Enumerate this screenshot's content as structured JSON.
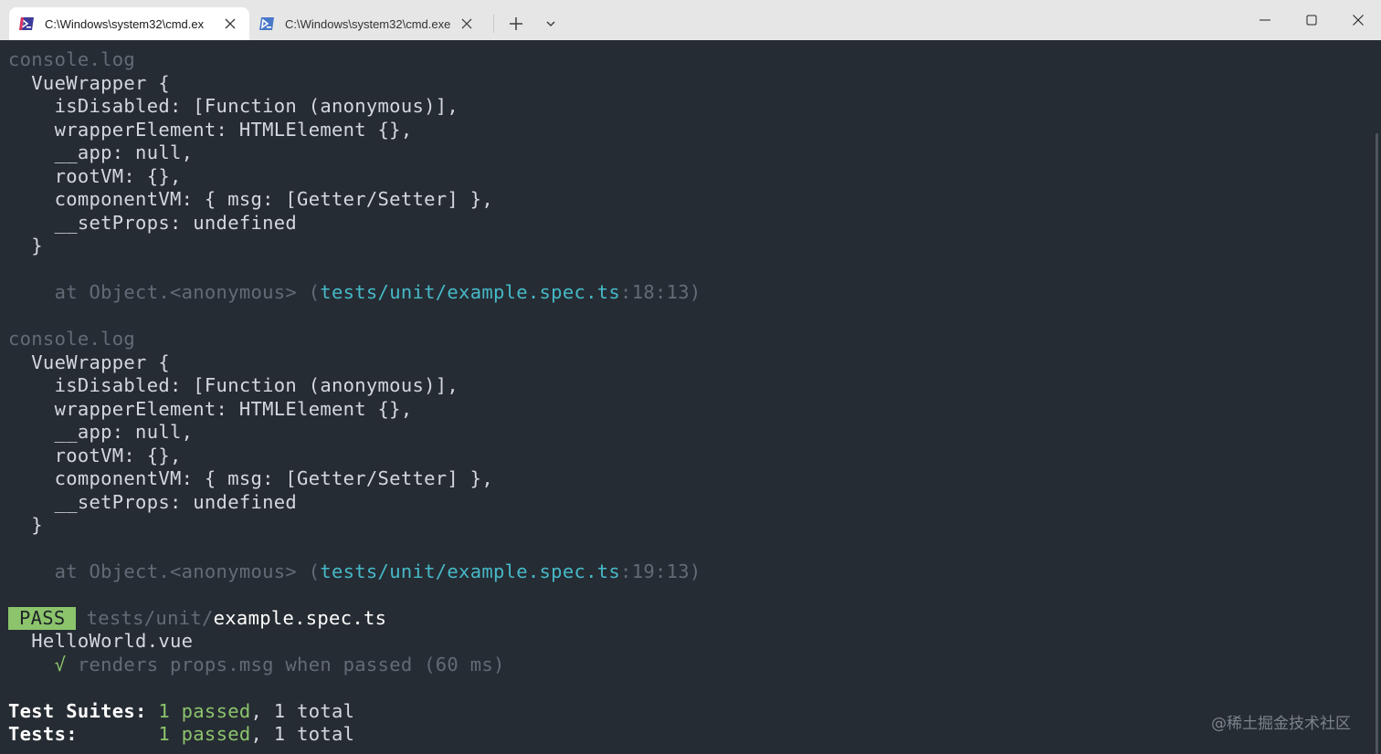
{
  "tabs": [
    {
      "title": "C:\\Windows\\system32\\cmd.ex",
      "active": true,
      "icon": "powershell-icon"
    },
    {
      "title": "C:\\Windows\\system32\\cmd.exe",
      "active": false,
      "icon": "powershell-icon"
    }
  ],
  "titlebar": {
    "new_tab_icon": "plus-icon",
    "dropdown_icon": "chevron-down-icon",
    "minimize_icon": "minimize-icon",
    "maximize_icon": "maximize-icon",
    "close_icon": "close-icon"
  },
  "colors": {
    "terminal_bg": "#262c33",
    "text": "#d4d8de",
    "dim": "#626b76",
    "path_cyan": "#46b9c8",
    "pass_green": "#8cc46c"
  },
  "log1": {
    "header": "console.log",
    "l1": "  VueWrapper {",
    "l2": "    isDisabled: [Function (anonymous)],",
    "l3": "    wrapperElement: HTMLElement {},",
    "l4": "    __app: null,",
    "l5": "    rootVM: {},",
    "l6": "    componentVM: { msg: [Getter/Setter] },",
    "l7": "    __setProps: undefined",
    "l8": "  }",
    "at_prefix": "    at Object.<anonymous> (",
    "at_path": "tests/unit/example.spec.ts",
    "at_suffix": ":18:13)"
  },
  "log2": {
    "header": "console.log",
    "l1": "  VueWrapper {",
    "l2": "    isDisabled: [Function (anonymous)],",
    "l3": "    wrapperElement: HTMLElement {},",
    "l4": "    __app: null,",
    "l5": "    rootVM: {},",
    "l6": "    componentVM: { msg: [Getter/Setter] },",
    "l7": "    __setProps: undefined",
    "l8": "  }",
    "at_prefix": "    at Object.<anonymous> (",
    "at_path": "tests/unit/example.spec.ts",
    "at_suffix": ":19:13)"
  },
  "result": {
    "badge": "PASS",
    "dir": "tests/unit/",
    "file": "example.spec.ts",
    "suite": "  HelloWorld.vue",
    "check": "    √",
    "test_name": " renders props.msg when passed (60 ms)"
  },
  "summary": {
    "suites_label": "Test Suites: ",
    "suites_passed": "1 passed",
    "suites_total": ", 1 total",
    "tests_label": "Tests:       ",
    "tests_passed": "1 passed",
    "tests_total": ", 1 total"
  },
  "watermark": "@稀土掘金技术社区"
}
